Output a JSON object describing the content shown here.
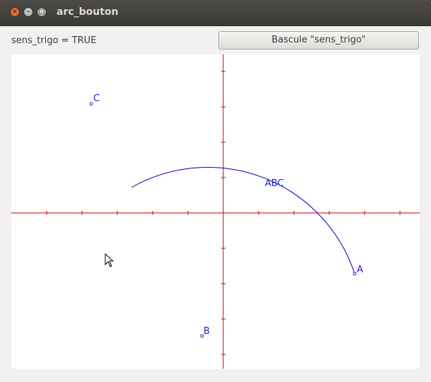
{
  "window": {
    "title": "arc_bouton",
    "controls": {
      "close": "×",
      "minimize": "–",
      "maximize": "□"
    }
  },
  "status": {
    "text": "sens_trigo = TRUE"
  },
  "toolbar": {
    "toggle_label": "Bascule \"sens_trigo\""
  },
  "figure": {
    "points": [
      {
        "name": "A",
        "label": "A"
      },
      {
        "name": "B",
        "label": "B"
      },
      {
        "name": "C",
        "label": "C"
      }
    ],
    "arc_label": "ABC",
    "colors": {
      "axes": "#cc0000",
      "arc": "#0000c0",
      "points": "#1a1ad6"
    }
  },
  "cursor": {
    "icon": "arrow-pointer-icon"
  }
}
